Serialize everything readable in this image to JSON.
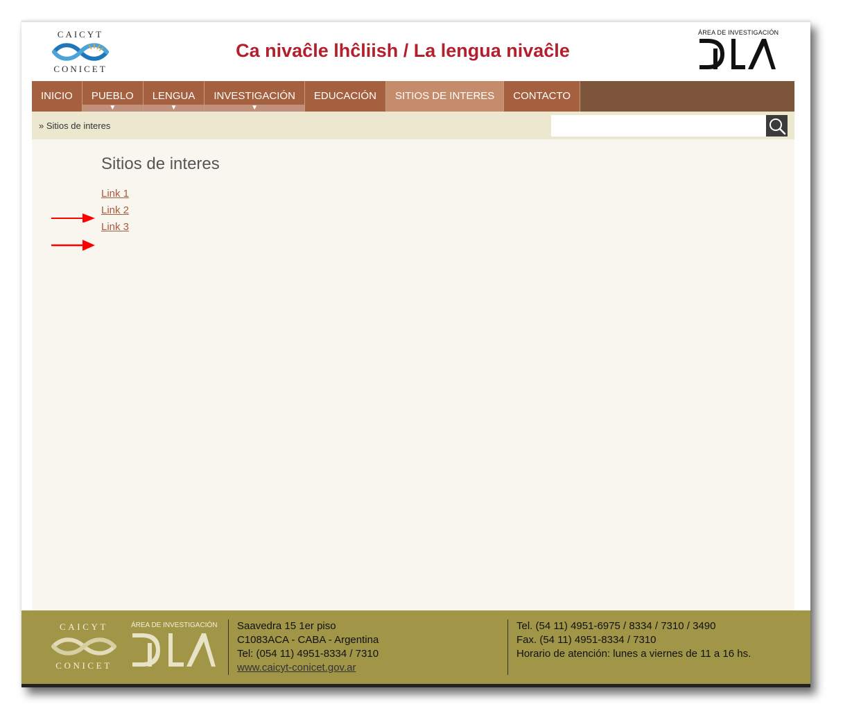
{
  "header": {
    "title": "Ca nivaĉle lhĉliish / La lengua nivaĉle",
    "logo_left_top": "CAICYT",
    "logo_left_bottom": "CONICET",
    "logo_right_area": "ÁREA DE INVESTIGACIÓN",
    "logo_right_name": "DILA"
  },
  "nav": {
    "items": [
      {
        "label": "INICIO",
        "dropdown": false,
        "active": false
      },
      {
        "label": "PUEBLO",
        "dropdown": true,
        "active": false
      },
      {
        "label": "LENGUA",
        "dropdown": true,
        "active": false
      },
      {
        "label": "INVESTIGACIÓN",
        "dropdown": true,
        "active": false
      },
      {
        "label": "EDUCACIÓN",
        "dropdown": false,
        "active": false
      },
      {
        "label": "SITIOS DE INTERES",
        "dropdown": false,
        "active": true
      },
      {
        "label": "CONTACTO",
        "dropdown": false,
        "active": false
      }
    ],
    "dropdown_glyph": "▼"
  },
  "breadcrumb": "» Sitios de interes",
  "search": {
    "value": "",
    "placeholder": "",
    "icon": "search-icon"
  },
  "main": {
    "title": "Sitios de interes",
    "links": [
      "Link 1",
      "Link 2",
      "Link 3"
    ],
    "annotation_arrows_on": [
      "Link 1",
      "Link 3"
    ],
    "annotation_color": "#ff0000"
  },
  "footer": {
    "logo_left_top": "CAICYT",
    "logo_left_bottom": "CONICET",
    "logo_right_area": "ÁREA DE INVESTIGACIÓN",
    "address": [
      "Saavedra 15 1er piso",
      "C1083ACA - CABA - Argentina",
      "Tel: (054 11) 4951-8334 / 7310"
    ],
    "website": "www.caicyt-conicet.gov.ar",
    "contact": [
      "Tel. (54 11) 4951-6975 / 8334 / 7310 / 3490",
      "Fax. (54 11) 4951-8334 / 7310",
      "Horario de atención: lunes a viernes de 11 a 16 hs."
    ]
  },
  "colors": {
    "title_red": "#b21f2d",
    "nav_item": "#a4603f",
    "nav_active": "#c58c6c",
    "nav_bg": "#7c553b",
    "crumb_bg": "#ece8d0",
    "link": "#a55d3e",
    "footer_bg": "#a19648"
  }
}
